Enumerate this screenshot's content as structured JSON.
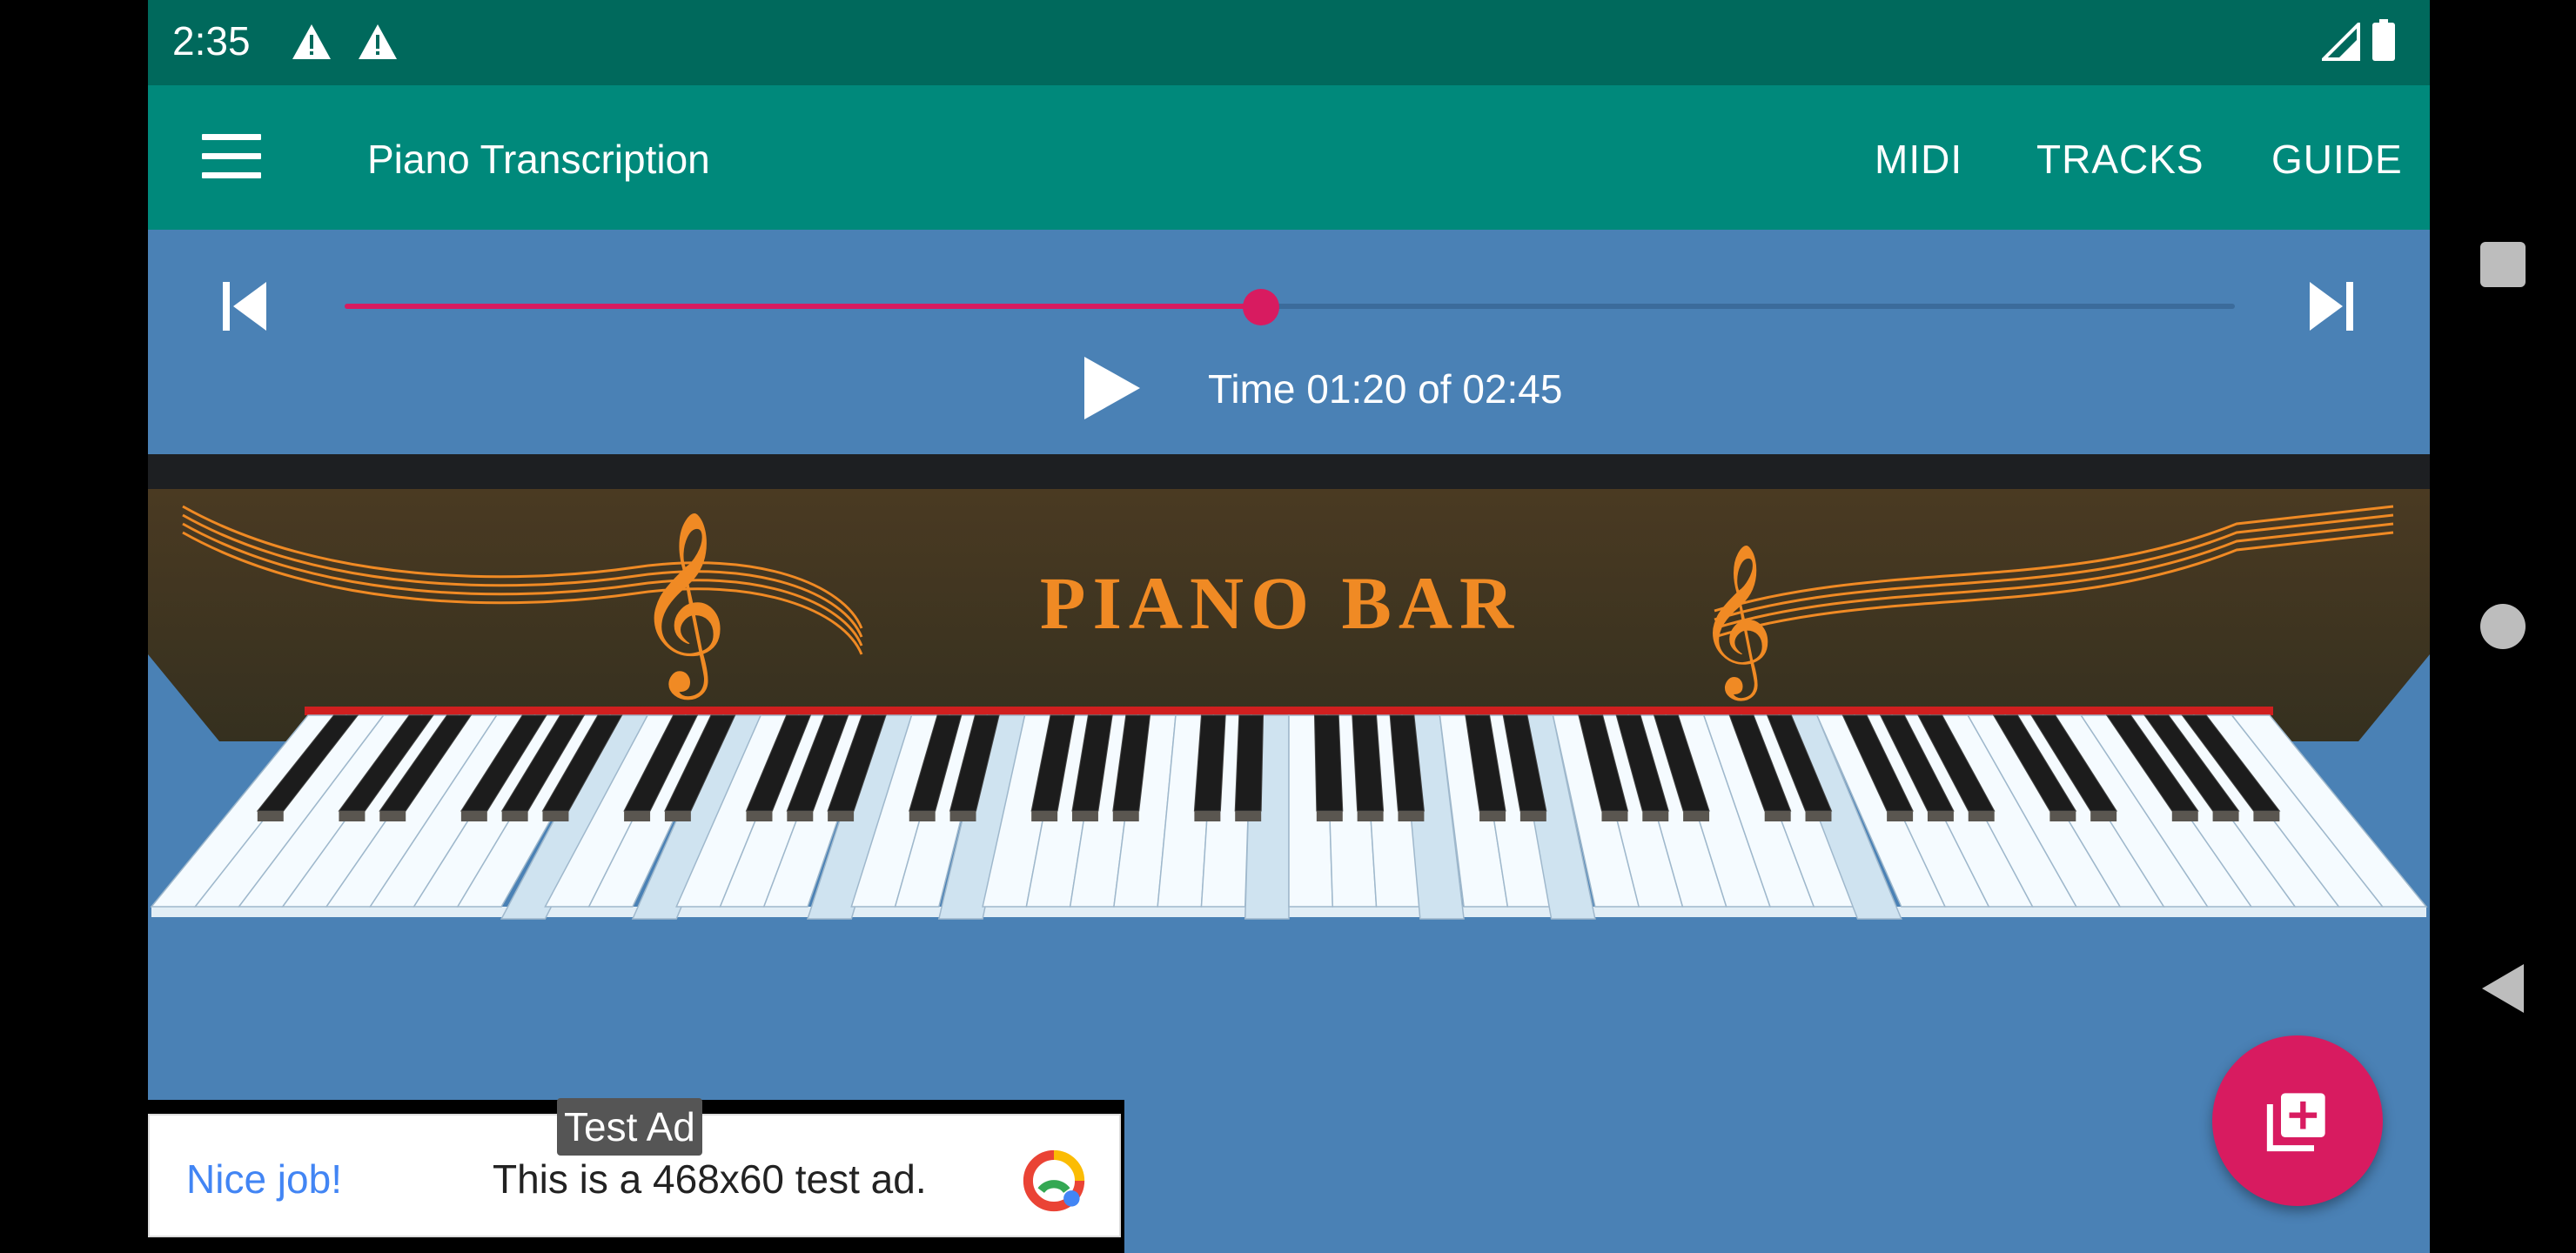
{
  "status_bar": {
    "time": "2:35",
    "icons": [
      "warning-icon",
      "warning-icon",
      "signal-icon",
      "battery-icon"
    ]
  },
  "app_bar": {
    "title": "Piano Transcription",
    "actions": [
      "MIDI",
      "TRACKS",
      "GUIDE"
    ],
    "menu_icon": "hamburger-menu-icon"
  },
  "player": {
    "time_text": "Time 01:20 of 02:45",
    "progress": 0.485,
    "prev_icon": "skip-previous-icon",
    "next_icon": "skip-next-icon",
    "play_icon": "play-icon"
  },
  "piano": {
    "brand": "PIANO BAR",
    "pressed_keys": [
      {
        "kind": "white",
        "index": 8
      },
      {
        "kind": "white",
        "index": 11
      },
      {
        "kind": "white",
        "index": 15
      },
      {
        "kind": "white",
        "index": 18
      },
      {
        "kind": "white",
        "index": 25
      },
      {
        "kind": "white",
        "index": 29
      },
      {
        "kind": "white",
        "index": 32
      },
      {
        "kind": "white",
        "index": 39
      }
    ]
  },
  "fab": {
    "icon": "add-to-library-icon"
  },
  "ad": {
    "label": "Test Ad",
    "headline": "Nice job!",
    "description": "This is a 468x60 test ad.",
    "logo_icon": "ad-choices-logo-icon"
  },
  "colors": {
    "status_bar": "#00695c",
    "app_bar": "#00897b",
    "background": "#4a81b5",
    "accent": "#d81b60",
    "piano_text": "#f08a24"
  },
  "nav_bar": [
    "recents-square-icon",
    "home-circle-icon",
    "back-triangle-icon"
  ]
}
